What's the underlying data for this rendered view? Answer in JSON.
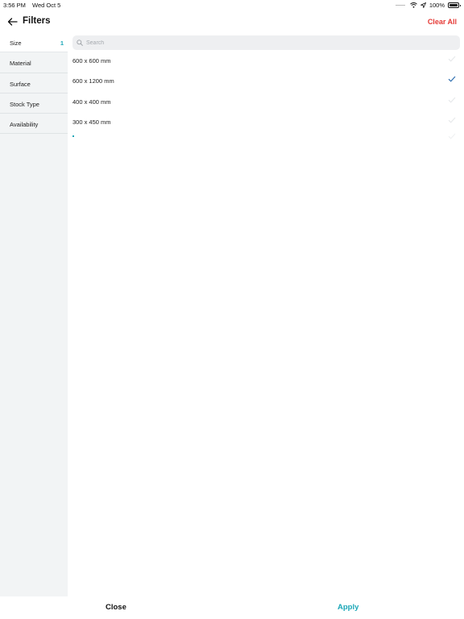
{
  "status_bar": {
    "time": "3:56 PM",
    "date": "Wed Oct 5",
    "battery": "100%"
  },
  "header": {
    "title": "Filters",
    "clear_all": "Clear All"
  },
  "sidebar": {
    "items": [
      {
        "label": "Size",
        "count": "1",
        "active": true
      },
      {
        "label": "Material",
        "count": ""
      },
      {
        "label": "Surface",
        "count": ""
      },
      {
        "label": "Stock Type",
        "count": ""
      },
      {
        "label": "Availability",
        "count": ""
      }
    ]
  },
  "search": {
    "placeholder": "Search",
    "value": ""
  },
  "options": [
    {
      "label": "600 x 600 mm",
      "selected": false
    },
    {
      "label": "600 x 1200 mm",
      "selected": true
    },
    {
      "label": "400 x 400 mm",
      "selected": false
    },
    {
      "label": "300 x 450 mm",
      "selected": false
    }
  ],
  "footer": {
    "close_label": "Close",
    "apply_label": "Apply"
  },
  "colors": {
    "accent": "#1aa6b7",
    "danger": "#e53935",
    "sidebar_bg": "#f2f4f5"
  }
}
